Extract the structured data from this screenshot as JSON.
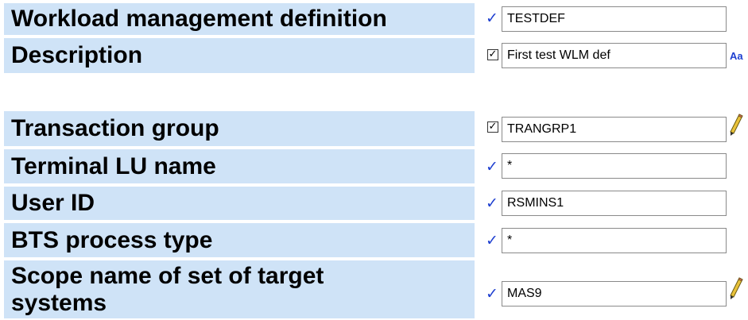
{
  "rows": [
    {
      "label": "Workload management definition",
      "marker": "check",
      "value": "TESTDEF"
    },
    {
      "label": "Description",
      "marker": "checkbox",
      "value": "First test WLM def",
      "extra_icon": "text-case-icon",
      "extra_text": "Aa"
    },
    {
      "label": "Transaction group",
      "marker": "checkbox",
      "value": "TRANGRP1",
      "extra_icon": "pencil-icon"
    },
    {
      "label": "Terminal LU name",
      "marker": "check",
      "value": "*"
    },
    {
      "label": "User ID",
      "marker": "check",
      "value": "RSMINS1"
    },
    {
      "label": "BTS process type",
      "marker": "check",
      "value": "*"
    },
    {
      "label": "Scope name of set of target systems",
      "marker": "check",
      "value": "MAS9",
      "extra_icon": "pencil-icon"
    }
  ],
  "colors": {
    "label_bg": "#cfe3f7",
    "check_mark": "#1e3fd0",
    "aa_icon": "#1e3fd0"
  }
}
